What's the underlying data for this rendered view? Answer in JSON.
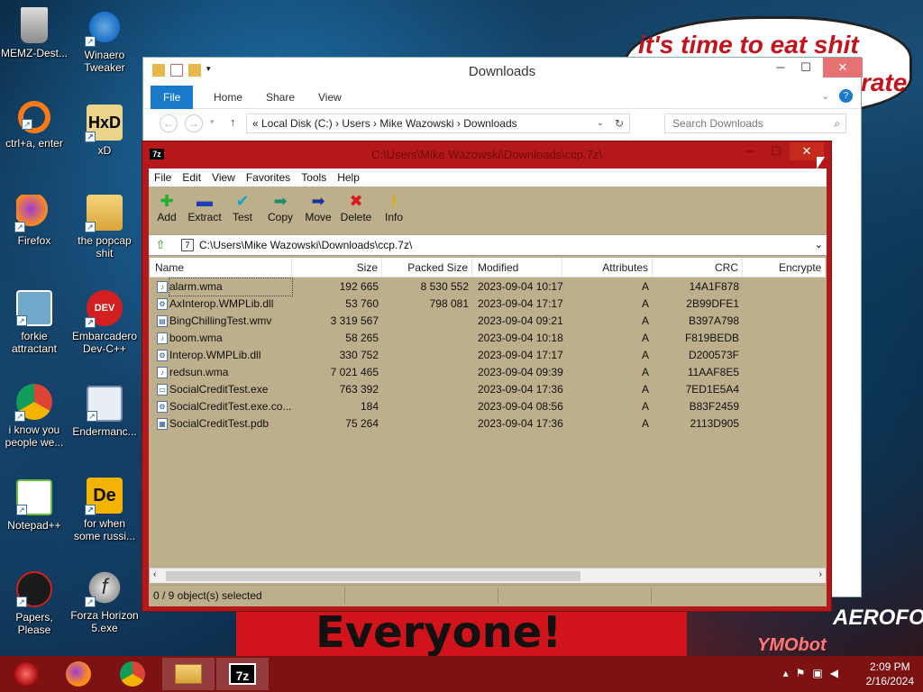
{
  "wallpaper": {
    "bubble_text": "it's time to eat shit",
    "bubble_text_partial": "rate",
    "banner_text": "Everyone!",
    "right_tag": "AEROFOS",
    "right_tag2": "YMObot"
  },
  "desktop_icons": [
    {
      "label": "MEMZ-Dest..."
    },
    {
      "label": "Winaero Tweaker"
    },
    {
      "label": "ctrl+a, enter"
    },
    {
      "label": "xD"
    },
    {
      "label": "Firefox"
    },
    {
      "label": "the popcap shit"
    },
    {
      "label": "forkie attractant"
    },
    {
      "label": "Embarcadero Dev-C++"
    },
    {
      "label": "i know you people we..."
    },
    {
      "label": "Endermanc..."
    },
    {
      "label": "Notepad++"
    },
    {
      "label": "for when some russi..."
    },
    {
      "label": "Papers, Please"
    },
    {
      "label": "Forza Horizon 5.exe"
    }
  ],
  "explorer": {
    "title": "Downloads",
    "ribbon_tabs": [
      "File",
      "Home",
      "Share",
      "View"
    ],
    "breadcrumb": "«  Local Disk (C:)  ›  Users  ›  Mike Wazowski  ›  Downloads",
    "search_placeholder": "Search Downloads"
  },
  "sevenzip": {
    "title": "C:\\Users\\Mike Wazowski\\Downloads\\ccp.7z\\",
    "menu": [
      "File",
      "Edit",
      "View",
      "Favorites",
      "Tools",
      "Help"
    ],
    "toolbar": [
      "Add",
      "Extract",
      "Test",
      "Copy",
      "Move",
      "Delete",
      "Info"
    ],
    "path": "C:\\Users\\Mike Wazowski\\Downloads\\ccp.7z\\",
    "columns": [
      "Name",
      "Size",
      "Packed Size",
      "Modified",
      "Attributes",
      "CRC",
      "Encrypte"
    ],
    "files": [
      {
        "name": "alarm.wma",
        "size": "192 665",
        "packed": "8 530 552",
        "modified": "2023-09-04 10:17",
        "attr": "A",
        "crc": "14A1F878"
      },
      {
        "name": "AxInterop.WMPLib.dll",
        "size": "53 760",
        "packed": "798 081",
        "modified": "2023-09-04 17:17",
        "attr": "A",
        "crc": "2B99DFE1"
      },
      {
        "name": "BingChillingTest.wmv",
        "size": "3 319 567",
        "packed": "",
        "modified": "2023-09-04 09:21",
        "attr": "A",
        "crc": "B397A798"
      },
      {
        "name": "boom.wma",
        "size": "58 265",
        "packed": "",
        "modified": "2023-09-04 10:18",
        "attr": "A",
        "crc": "F819BEDB"
      },
      {
        "name": "Interop.WMPLib.dll",
        "size": "330 752",
        "packed": "",
        "modified": "2023-09-04 17:17",
        "attr": "A",
        "crc": "D200573F"
      },
      {
        "name": "redsun.wma",
        "size": "7 021 465",
        "packed": "",
        "modified": "2023-09-04 09:39",
        "attr": "A",
        "crc": "11AAF8E5"
      },
      {
        "name": "SocialCreditTest.exe",
        "size": "763 392",
        "packed": "",
        "modified": "2023-09-04 17:36",
        "attr": "A",
        "crc": "7ED1E5A4"
      },
      {
        "name": "SocialCreditTest.exe.co...",
        "size": "184",
        "packed": "",
        "modified": "2023-09-04 08:56",
        "attr": "A",
        "crc": "B83F2459"
      },
      {
        "name": "SocialCreditTest.pdb",
        "size": "75 264",
        "packed": "",
        "modified": "2023-09-04 17:36",
        "attr": "A",
        "crc": "2113D905"
      }
    ],
    "status": "0 / 9 object(s) selected"
  },
  "taskbar": {
    "time": "2:09 PM",
    "date": "2/16/2024"
  },
  "colors": {
    "window_accent": "#b4181b",
    "panel_bg": "#bdae8c",
    "taskbar": "#7d1213"
  }
}
